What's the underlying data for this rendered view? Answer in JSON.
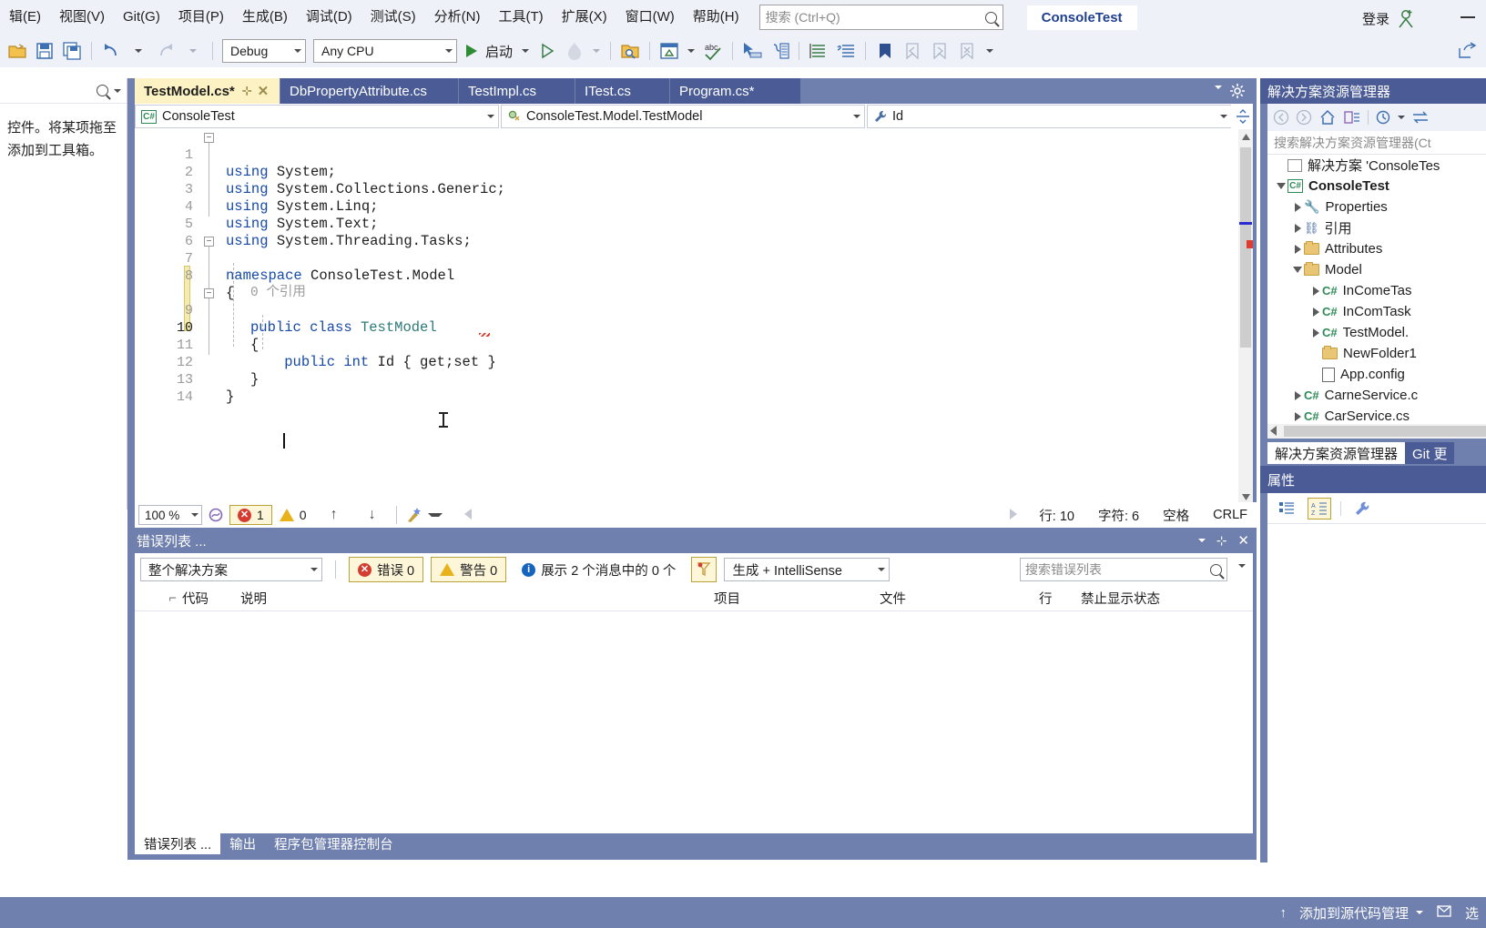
{
  "menu": {
    "items": [
      "辑(E)",
      "视图(V)",
      "Git(G)",
      "项目(P)",
      "生成(B)",
      "调试(D)",
      "测试(S)",
      "分析(N)",
      "工具(T)",
      "扩展(X)",
      "窗口(W)",
      "帮助(H)"
    ],
    "search_placeholder": "搜索 (Ctrl+Q)",
    "project_chip": "ConsoleTest",
    "signin_label": "登录"
  },
  "toolbar": {
    "config": "Debug",
    "platform": "Any CPU",
    "run_label": "启动"
  },
  "toolbox": {
    "text": "控件。将某项拖至添加到工具箱。"
  },
  "editor": {
    "tabs": [
      {
        "label": "TestModel.cs*",
        "active": true
      },
      {
        "label": "DbPropertyAttribute.cs",
        "active": false
      },
      {
        "label": "TestImpl.cs",
        "active": false
      },
      {
        "label": "ITest.cs",
        "active": false
      },
      {
        "label": "Program.cs*",
        "active": false
      }
    ],
    "nav_project": "ConsoleTest",
    "nav_type": "ConsoleTest.Model.TestModel",
    "nav_member": "Id",
    "codelens": "0 个引用",
    "lines": [
      {
        "n": "1",
        "text": "using System;"
      },
      {
        "n": "2",
        "text": "using System.Collections.Generic;"
      },
      {
        "n": "3",
        "text": "using System.Linq;"
      },
      {
        "n": "4",
        "text": "using System.Text;"
      },
      {
        "n": "5",
        "text": "using System.Threading.Tasks;"
      },
      {
        "n": "6",
        "text": ""
      },
      {
        "n": "7",
        "text": "namespace ConsoleTest.Model"
      },
      {
        "n": "8",
        "text": "{"
      },
      {
        "n": "9",
        "text": "    public class TestModel"
      },
      {
        "n": "10",
        "text": "    {"
      },
      {
        "n": "11",
        "text": "        public int Id { get;set }"
      },
      {
        "n": "12",
        "text": "    }"
      },
      {
        "n": "13",
        "text": "}"
      },
      {
        "n": "14",
        "text": ""
      }
    ],
    "status": {
      "zoom": "100 %",
      "errors": "1",
      "warnings": "0",
      "line": "行: 10",
      "col": "字符: 6",
      "spaces": "空格",
      "eol": "CRLF"
    }
  },
  "error_list": {
    "title": "错误列表 ...",
    "scope": "整个解决方案",
    "errors_label": "错误 0",
    "warnings_label": "警告 0",
    "messages_label": "展示 2 个消息中的 0 个",
    "build_filter": "生成 + IntelliSense",
    "search_placeholder": "搜索错误列表",
    "columns": [
      "代码",
      "说明",
      "项目",
      "文件",
      "行",
      "禁止显示状态"
    ],
    "rows": [],
    "tabs": [
      {
        "label": "错误列表 ...",
        "active": true
      },
      {
        "label": "输出",
        "active": false
      },
      {
        "label": "程序包管理器控制台",
        "active": false
      }
    ]
  },
  "solution_explorer": {
    "title": "解决方案资源管理器",
    "search_placeholder": "搜索解决方案资源管理器(Ct",
    "tree": [
      {
        "indent": 0,
        "arrow": "none",
        "icon": "solution-icon",
        "label": "解决方案 'ConsoleTes",
        "bold": false
      },
      {
        "indent": 0,
        "arrow": "open",
        "icon": "project-icon",
        "label": "ConsoleTest",
        "bold": true
      },
      {
        "indent": 1,
        "arrow": "closed",
        "icon": "wrench-icon",
        "label": "Properties",
        "bold": false
      },
      {
        "indent": 1,
        "arrow": "closed",
        "icon": "references-icon",
        "label": "引用",
        "bold": false
      },
      {
        "indent": 1,
        "arrow": "closed",
        "icon": "folder-icon",
        "label": "Attributes",
        "bold": false
      },
      {
        "indent": 1,
        "arrow": "open",
        "icon": "folder-icon",
        "label": "Model",
        "bold": false
      },
      {
        "indent": 2,
        "arrow": "closed",
        "icon": "csharp-icon",
        "label": "InComeTas",
        "bold": false
      },
      {
        "indent": 2,
        "arrow": "closed",
        "icon": "csharp-icon",
        "label": "InComTask",
        "bold": false
      },
      {
        "indent": 2,
        "arrow": "closed",
        "icon": "csharp-icon",
        "label": "TestModel.",
        "bold": false
      },
      {
        "indent": 2,
        "arrow": "none",
        "icon": "folder-icon",
        "label": "NewFolder1",
        "bold": false
      },
      {
        "indent": 2,
        "arrow": "none",
        "icon": "config-icon",
        "label": "App.config",
        "bold": false
      },
      {
        "indent": 1,
        "arrow": "closed",
        "icon": "csharp-icon",
        "label": "CarneService.c",
        "bold": false
      },
      {
        "indent": 1,
        "arrow": "closed",
        "icon": "csharp-icon",
        "label": "CarService.cs",
        "bold": false
      }
    ],
    "tabs": [
      {
        "label": "解决方案资源管理器",
        "active": true
      },
      {
        "label": "Git 更",
        "active": false
      }
    ],
    "properties_title": "属性"
  },
  "statusbar": {
    "source_control": "添加到源代码管理",
    "right_text": "选"
  },
  "colors": {
    "chrome": "#6f7fae",
    "tab_active": "#fdf2c4",
    "tab_inactive": "#4a5b96",
    "keyword": "#1749a8",
    "type": "#2b7a78",
    "error": "#d63b2f",
    "warning": "#e8b21c",
    "accent_blue": "#1f3f8f"
  }
}
